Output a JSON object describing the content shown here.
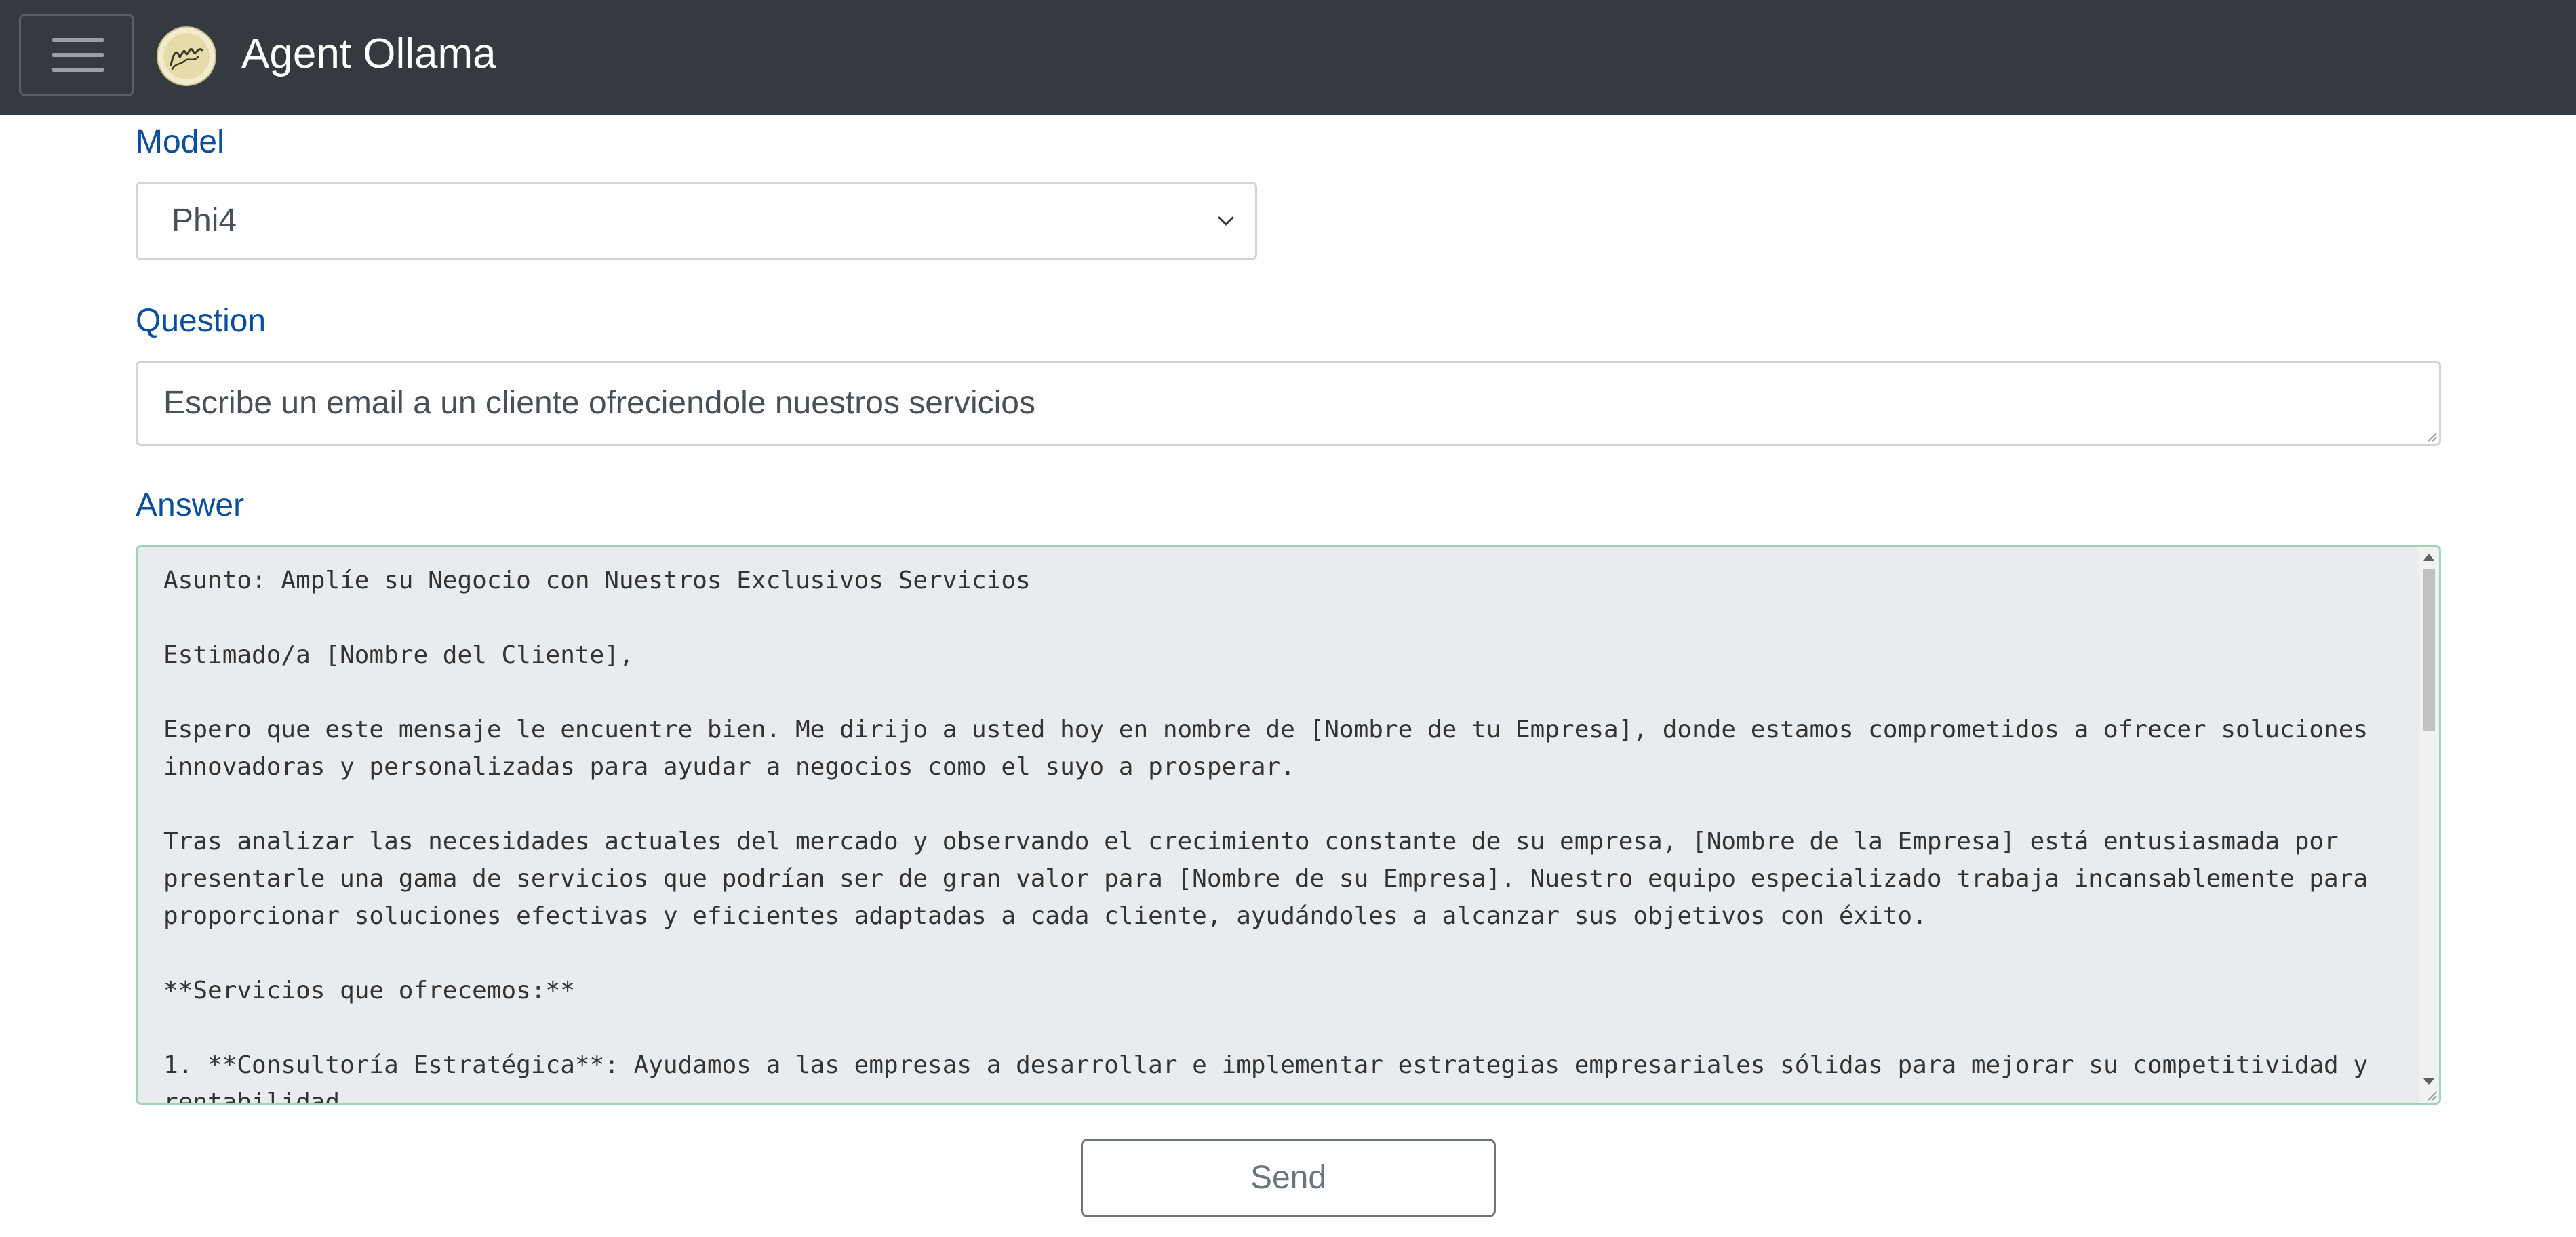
{
  "navbar": {
    "brand": "Agent Ollama",
    "menu_icon": "hamburger-menu-icon",
    "logo_icon": "ollama-logo-icon",
    "background_color": "#343a40"
  },
  "form": {
    "model_label": "Model",
    "model_selected": "Phi4",
    "question_label": "Question",
    "question_value": "Escribe un email a un cliente ofreciendole nuestros servicios",
    "answer_label": "Answer",
    "answer_value": "Asunto: Amplíe su Negocio con Nuestros Exclusivos Servicios\n\nEstimado/a [Nombre del Cliente],\n\nEspero que este mensaje le encuentre bien. Me dirijo a usted hoy en nombre de [Nombre de tu Empresa], donde estamos comprometidos a ofrecer soluciones innovadoras y personalizadas para ayudar a negocios como el suyo a prosperar.\n\nTras analizar las necesidades actuales del mercado y observando el crecimiento constante de su empresa, [Nombre de la Empresa] está entusiasmada por presentarle una gama de servicios que podrían ser de gran valor para [Nombre de su Empresa]. Nuestro equipo especializado trabaja incansablemente para proporcionar soluciones efectivas y eficientes adaptadas a cada cliente, ayudándoles a alcanzar sus objetivos con éxito.\n\n**Servicios que ofrecemos:**\n\n1. **Consultoría Estratégica**: Ayudamos a las empresas a desarrollar e implementar estrategias empresariales sólidas para mejorar su competitividad y rentabilidad.",
    "send_label": "Send",
    "label_color": "#0b4f9c"
  }
}
